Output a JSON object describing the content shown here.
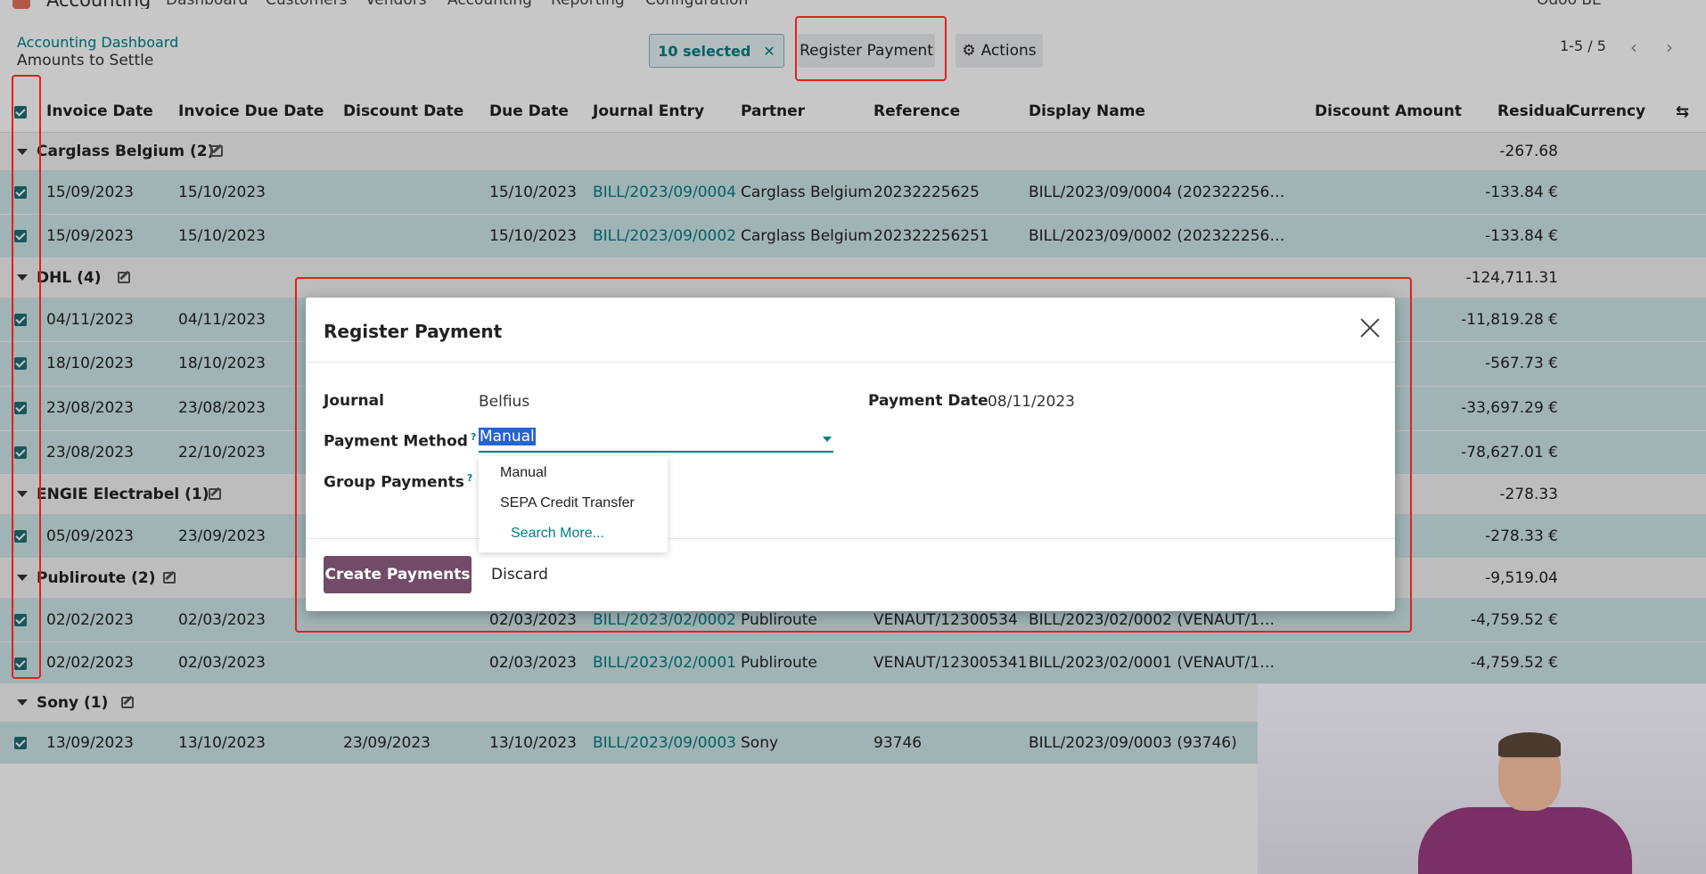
{
  "topnav": {
    "app_name": "Accounting",
    "menu": [
      "Dashboard",
      "Customers",
      "Vendors",
      "Accounting",
      "Reporting",
      "Configuration"
    ],
    "company": "Odoo BE"
  },
  "control": {
    "breadcrumb": "Accounting Dashboard",
    "title": "Amounts to Settle",
    "selected_label": "10 selected",
    "register_label": "Register Payment",
    "actions_label": "Actions",
    "pager": "1-5 / 5"
  },
  "table": {
    "columns": [
      "Invoice Date",
      "Invoice Due Date",
      "Discount Date",
      "Due Date",
      "Journal Entry",
      "Partner",
      "Reference",
      "Display Name",
      "Discount Amount",
      "Residual",
      "Currency"
    ],
    "groups": [
      {
        "name": "Carglass Belgium (2)",
        "total": "-267.68"
      },
      {
        "name": "DHL (4)",
        "total": "-124,711.31"
      },
      {
        "name": "ENGIE Electrabel (1)",
        "total": "-278.33"
      },
      {
        "name": "Publiroute (2)",
        "total": "-9,519.04"
      },
      {
        "name": "Sony (1)",
        "total": ""
      }
    ],
    "rows": [
      {
        "invoice_date": "15/09/2023",
        "invoice_due": "15/10/2023",
        "discount_date": "",
        "due_date": "15/10/2023",
        "journal": "BILL/2023/09/0004",
        "partner": "Carglass Belgium",
        "reference": "20232225625",
        "display": "BILL/2023/09/0004 (202322256…",
        "residual": "-133.84 €"
      },
      {
        "invoice_date": "15/09/2023",
        "invoice_due": "15/10/2023",
        "discount_date": "",
        "due_date": "15/10/2023",
        "journal": "BILL/2023/09/0002",
        "partner": "Carglass Belgium",
        "reference": "202322256251",
        "display": "BILL/2023/09/0002 (202322256…",
        "residual": "-133.84 €"
      },
      {
        "invoice_date": "04/11/2023",
        "invoice_due": "04/11/2023",
        "residual": "-11,819.28 €"
      },
      {
        "invoice_date": "18/10/2023",
        "invoice_due": "18/10/2023",
        "residual": "-567.73 €"
      },
      {
        "invoice_date": "23/08/2023",
        "invoice_due": "23/08/2023",
        "residual": "-33,697.29 €"
      },
      {
        "invoice_date": "23/08/2023",
        "invoice_due": "22/10/2023",
        "residual": "-78,627.01 €"
      },
      {
        "invoice_date": "05/09/2023",
        "invoice_due": "23/09/2023",
        "residual": "-278.33 €"
      },
      {
        "invoice_date": "02/02/2023",
        "invoice_due": "02/03/2023",
        "discount_date": "",
        "due_date": "02/03/2023",
        "journal": "BILL/2023/02/0002",
        "partner": "Publiroute",
        "reference": "VENAUT/12300534",
        "display": "BILL/2023/02/0002 (VENAUT/1…",
        "residual": "-4,759.52 €"
      },
      {
        "invoice_date": "02/02/2023",
        "invoice_due": "02/03/2023",
        "discount_date": "",
        "due_date": "02/03/2023",
        "journal": "BILL/2023/02/0001",
        "partner": "Publiroute",
        "reference": "VENAUT/123005341",
        "display": "BILL/2023/02/0001 (VENAUT/1…",
        "residual": "-4,759.52 €"
      },
      {
        "invoice_date": "13/09/2023",
        "invoice_due": "13/10/2023",
        "discount_date": "23/09/2023",
        "due_date": "13/10/2023",
        "journal": "BILL/2023/09/0003",
        "partner": "Sony",
        "reference": "93746",
        "display": "BILL/2023/09/0003 (93746)",
        "residual": ""
      }
    ]
  },
  "modal": {
    "title": "Register Payment",
    "journal_label": "Journal",
    "journal_value": "Belfius",
    "payment_date_label": "Payment Date",
    "payment_date_value": "08/11/2023",
    "method_label": "Payment Method",
    "method_value": "Manual",
    "group_label": "Group Payments",
    "help_mark": "?",
    "dropdown": [
      "Manual",
      "SEPA Credit Transfer",
      "Search More..."
    ],
    "create_label": "Create Payments",
    "discard_label": "Discard"
  },
  "colors": {
    "accent": "#017e84",
    "primary": "#714b67",
    "highlight": "#e02020"
  }
}
